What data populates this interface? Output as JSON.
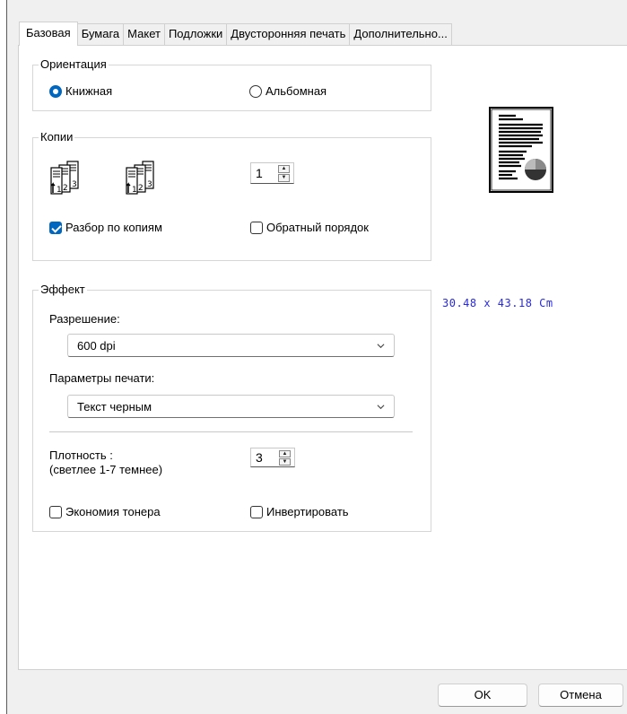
{
  "tabs": [
    "Базовая",
    "Бумага",
    "Макет",
    "Подложки",
    "Двусторонняя печать",
    "Дополнительно..."
  ],
  "active_tab": "Базовая",
  "orientation": {
    "title": "Ориентация",
    "portrait": "Книжная",
    "landscape": "Альбомная",
    "selected": "portrait"
  },
  "copies": {
    "title": "Копии",
    "count": "1",
    "collate_label": "Разбор по копиям",
    "collate_checked": true,
    "reverse_label": "Обратный порядок",
    "reverse_checked": false
  },
  "preview": {
    "dimensions": "30.48 x 43.18 Cm"
  },
  "effect": {
    "title": "Эффект",
    "resolution_label": "Разрешение:",
    "resolution_value": "600 dpi",
    "print_params_label": "Параметры печати:",
    "print_params_value": "Текст черным",
    "density_label": "Плотность :",
    "density_hint": "(светлее 1-7 темнее)",
    "density_value": "3",
    "toner_save_label": "Экономия тонера",
    "toner_save_checked": false,
    "invert_label": "Инвертировать",
    "invert_checked": false
  },
  "buttons": {
    "ok": "OK",
    "cancel": "Отмена"
  },
  "colors": {
    "accent": "#0067c0",
    "dimension_text": "#2a2ad8"
  }
}
